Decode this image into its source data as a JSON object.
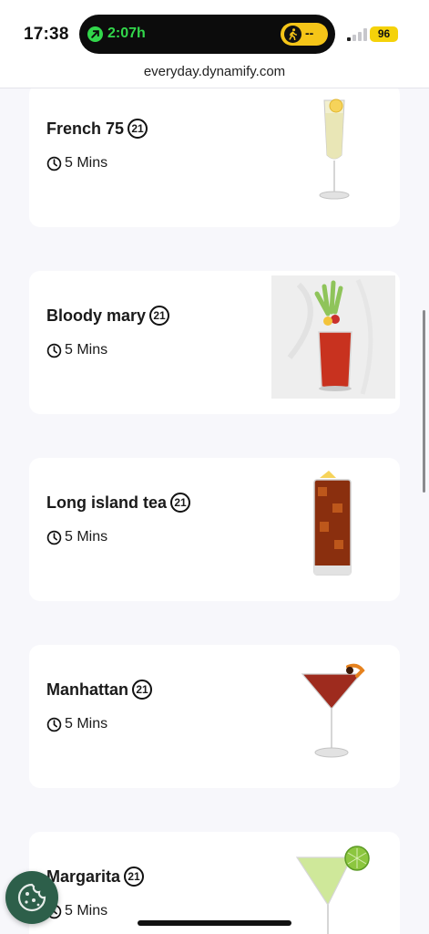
{
  "status": {
    "time": "17:38",
    "timer": "2:07h",
    "activity": "--",
    "battery": "96"
  },
  "browser": {
    "url": "everyday.dynamify.com"
  },
  "age_label": "21",
  "cards": [
    {
      "name": "French 75",
      "duration": "5 Mins"
    },
    {
      "name": "Bloody mary",
      "duration": "5 Mins"
    },
    {
      "name": "Long island tea",
      "duration": "5 Mins"
    },
    {
      "name": "Manhattan",
      "duration": "5 Mins"
    },
    {
      "name": "Margarita",
      "duration": "5 Mins"
    }
  ]
}
